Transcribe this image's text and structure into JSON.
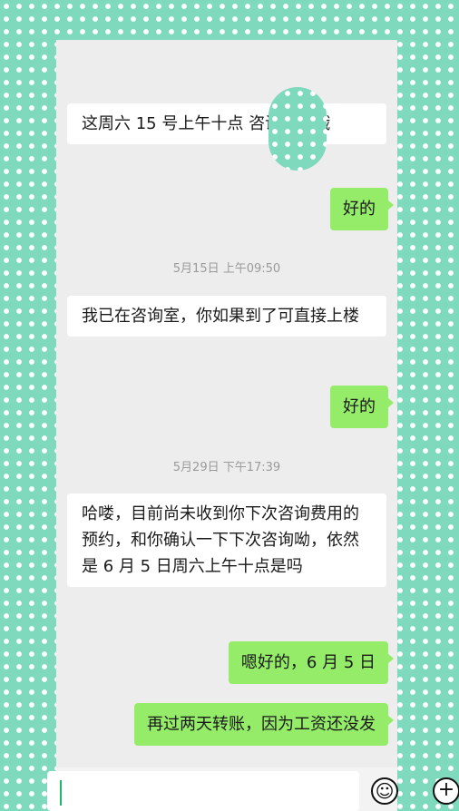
{
  "messages": [
    {
      "side": "in",
      "text": "这周六 15 号上午十点 咨询室见哦"
    },
    {
      "side": "out",
      "text": "好的"
    },
    {
      "type": "timestamp",
      "text": "5月15日 上午09:50"
    },
    {
      "side": "in",
      "text": "我已在咨询室，你如果到了可直接上楼"
    },
    {
      "side": "out",
      "text": "好的"
    },
    {
      "type": "timestamp",
      "text": "5月29日 下午17:39"
    },
    {
      "side": "in",
      "text": "哈喽，目前尚未收到你下次咨询费用的预约，和你确认一下下次咨询呦，依然是 6 月 5 日周六上午十点是吗"
    },
    {
      "side": "out",
      "text": "嗯好的，6 月 5 日"
    },
    {
      "side": "out",
      "text": "再过两天转账，因为工资还没发"
    }
  ],
  "input": {
    "value": ""
  },
  "icons": {
    "emoji": "emoji-icon",
    "plus": "plus-icon"
  }
}
